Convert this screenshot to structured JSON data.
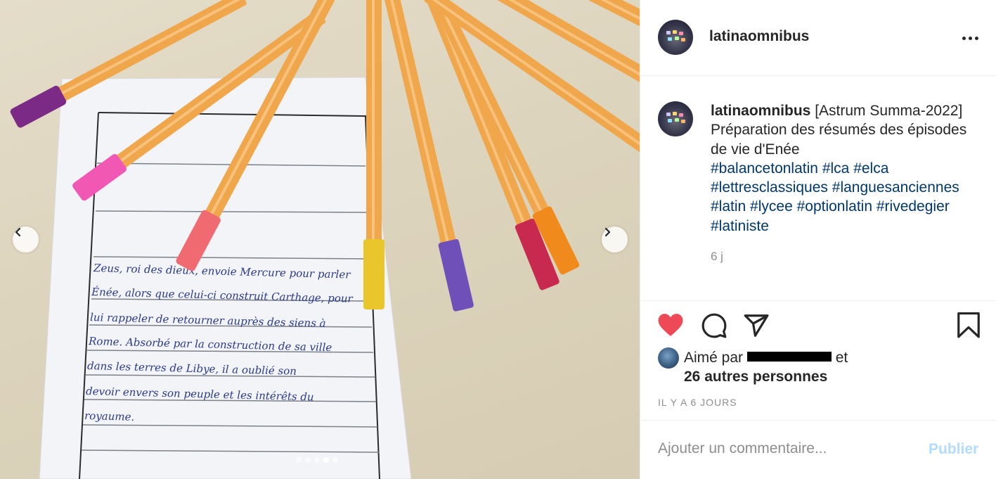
{
  "post": {
    "username": "latinaomnibus",
    "more_icon": "more-horizontal-icon",
    "carousel": {
      "total_slides": 5,
      "active_index": 3
    }
  },
  "photo_handwriting": [
    "Zeus, roi des dieux, envoie Mercure pour parler",
    "Énée, alors que celui-ci construit Carthage, pour",
    "lui rappeler de retourner auprès des siens à",
    "Rome. Absorbé par la construction de sa ville",
    "dans les terres de Libye, il a oublié son",
    "devoir envers son peuple et les intérêts du",
    "royaume."
  ],
  "caption": {
    "username": "latinaomnibus",
    "text": "[Astrum Summa-2022] Préparation des résumés des épisodes de vie d'Enée",
    "hashtags": [
      "#balancetonlatin",
      "#lca",
      "#elca",
      "#lettresclassiques",
      "#languesanciennes",
      "#latin",
      "#lycee",
      "#optionlatin",
      "#rivedegier",
      "#latiniste"
    ],
    "time": "6 j"
  },
  "actions": {
    "like_icon": "heart-filled-icon",
    "comment_icon": "comment-icon",
    "share_icon": "paper-plane-icon",
    "save_icon": "bookmark-icon",
    "like_color": "#ed4956"
  },
  "likes": {
    "prefix": "Aimé par",
    "suffix": "et",
    "others": "26 autres personnes"
  },
  "posted_ago": "IL Y A 6 JOURS",
  "comment": {
    "placeholder": "Ajouter un commentaire...",
    "post_label": "Publier"
  }
}
